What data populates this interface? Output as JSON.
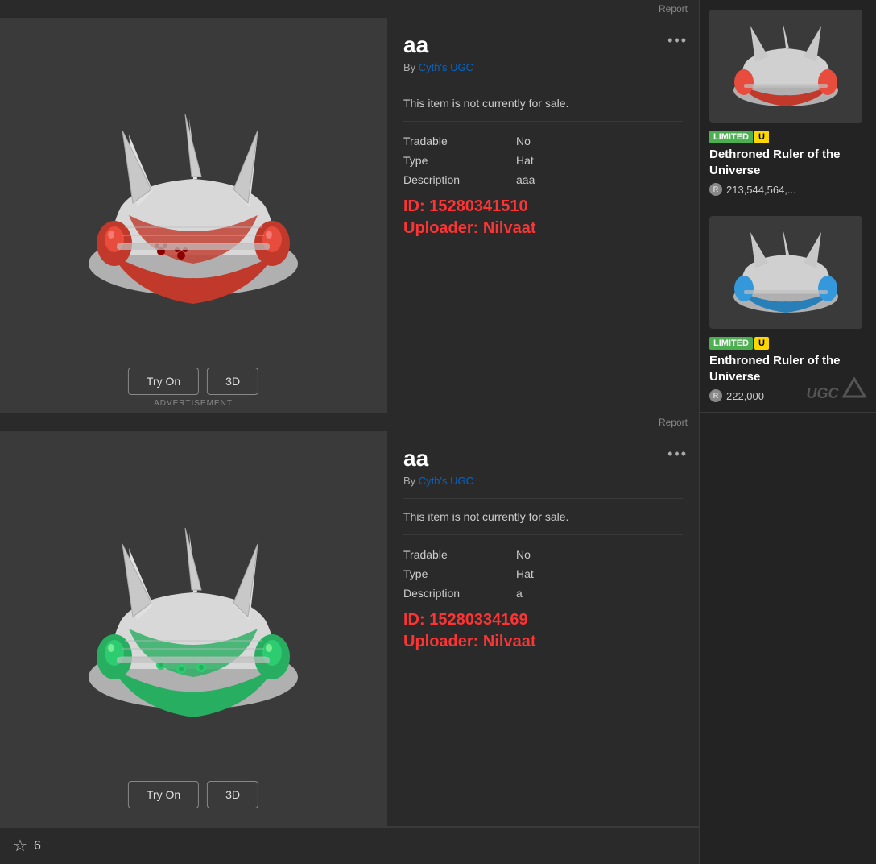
{
  "items": [
    {
      "title": "aa",
      "creator": "Cyth's UGC",
      "sale_status": "This item is not currently for sale.",
      "tradable_label": "Tradable",
      "tradable_value": "No",
      "type_label": "Type",
      "type_value": "Hat",
      "description_label": "Description",
      "description_value": "aaa",
      "id_line": "ID: 15280341510",
      "uploader_line": "Uploader: Nilvaat",
      "try_on_label": "Try On",
      "three_d_label": "3D",
      "advertisement_label": "ADVERTISEMENT",
      "report_label": "Report",
      "more_options": "•••",
      "hat_color": "red"
    },
    {
      "title": "aa",
      "creator": "Cyth's UGC",
      "sale_status": "This item is not currently for sale.",
      "tradable_label": "Tradable",
      "tradable_value": "No",
      "type_label": "Type",
      "type_value": "Hat",
      "description_label": "Description",
      "description_value": "a",
      "id_line": "ID: 15280334169",
      "uploader_line": "Uploader: Nilvaat",
      "try_on_label": "Try On",
      "three_d_label": "3D",
      "advertisement_label": "",
      "report_label": "Report",
      "more_options": "•••",
      "hat_color": "green"
    }
  ],
  "side_items": [
    {
      "limited_text": "LIMITED",
      "unique_text": "U",
      "name": "Dethroned Ruler of the Universe",
      "price": "213,544,564,..."
    },
    {
      "limited_text": "LIMITED",
      "unique_text": "U",
      "name": "Enthroned Ruler of the Universe",
      "price": "222,000"
    }
  ],
  "bottom": {
    "favorite_count": "6",
    "ugc_label": "UGC"
  }
}
